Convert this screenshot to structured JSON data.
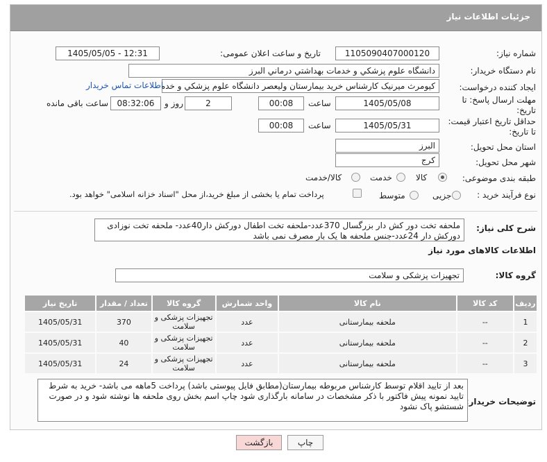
{
  "header": {
    "title": "جزئیات اطلاعات نیاز"
  },
  "fields": {
    "need_number": {
      "label": "شماره نیاز:",
      "value": "1105090407000120"
    },
    "announce_datetime": {
      "label": "تاریخ و ساعت اعلان عمومی:",
      "value": "1405/05/05 - 12:31"
    },
    "buyer_org": {
      "label": "نام دستگاه خریدار:",
      "value": "دانشگاه علوم پزشکي و خدمات بهداشتي  درماني البرز"
    },
    "requester": {
      "label": "ایجاد کننده درخواست:",
      "value": "کیومرث میرنیک کارشناس خرید بیمارستان ولیعصر دانشگاه علوم پزشکي و خدمات بهداشتي",
      "contact_link": "اطلاعات تماس خریدار"
    },
    "deadline": {
      "label_line1": "مهلت ارسال پاسخ: تا",
      "label_line2": "تاریخ:",
      "date": "1405/05/08",
      "time_label": "ساعت",
      "time": "00:08",
      "days": "2",
      "days_label": "روز و",
      "remaining": "08:32:06",
      "remaining_label": "ساعت باقی مانده"
    },
    "price_validity": {
      "label_line1": "حداقل تاریخ اعتبار قیمت:",
      "label_line2": "تا تاریخ:",
      "date": "1405/05/31",
      "time_label": "ساعت",
      "time": "00:08"
    },
    "province": {
      "label": "استان محل تحویل:",
      "value": "البرز"
    },
    "city": {
      "label": "شهر محل تحویل:",
      "value": "کرج"
    },
    "category": {
      "label": "طبقه بندی موضوعی:",
      "options": [
        "کالا",
        "خدمت",
        "کالا/خدمت"
      ],
      "selected": "کالا"
    },
    "purchase_type": {
      "label": "نوع فرآیند خرید :",
      "options": [
        "جزیی",
        "متوسط"
      ],
      "payment_note": "پرداخت تمام یا بخشی از مبلغ خرید،از محل \"اسناد خزانه اسلامی\" خواهد بود."
    }
  },
  "general_description": {
    "label": "شرح کلی نیاز:",
    "value": "ملحفه تخت دور کش دار بزرگسال 370عدد-ملحفه تخت اطفال دورکش دار40عدد- ملحفه تخت نوزادی دورکش دار 24عدد-جنس ملحفه ها یک بار مصرف نمی باشد"
  },
  "goods_section": {
    "title": "اطلاعات کالاهای مورد نیاز",
    "group_label": "گروه کالا:",
    "group_value": "تجهیزات پزشکی و سلامت"
  },
  "table": {
    "columns": [
      "ردیف",
      "کد کالا",
      "نام کالا",
      "واحد شمارش",
      "گروه کالا",
      "تعداد / مقدار",
      "تاریخ نیاز"
    ],
    "rows": [
      {
        "row": "1",
        "code": "--",
        "name": "ملحفه بیمارستانی",
        "unit": "عدد",
        "group": "تجهیزات پزشکی و سلامت",
        "qty": "370",
        "date": "1405/05/31"
      },
      {
        "row": "2",
        "code": "--",
        "name": "ملحفه بیمارستانی",
        "unit": "عدد",
        "group": "تجهیزات پزشکی و سلامت",
        "qty": "40",
        "date": "1405/05/31"
      },
      {
        "row": "3",
        "code": "--",
        "name": "ملحفه بیمارستانی",
        "unit": "عدد",
        "group": "تجهیزات پزشکی و سلامت",
        "qty": "24",
        "date": "1405/05/31"
      }
    ]
  },
  "buyer_notes": {
    "label": "توضیحات خریدار:",
    "value": "بعد از تایید اقلام توسط کارشناس مربوطه بیمارستان(مطابق فایل پیوستی باشد) پرداخت 5ماهه می باشد- خرید به شرط تایید نمونه پیش فاکتور با ذکر مشخصات در سامانه بارگذاری شود چاپ اسم بخش روی ملحفه ها نوشته شود و در صورت شستشو پاک نشود"
  },
  "buttons": {
    "print": "چاپ",
    "back": "بازگشت"
  },
  "colors": {
    "header_bg": "#a0a0a0",
    "back_button_bg": "#f8d7d7",
    "link": "#1f55b4"
  }
}
